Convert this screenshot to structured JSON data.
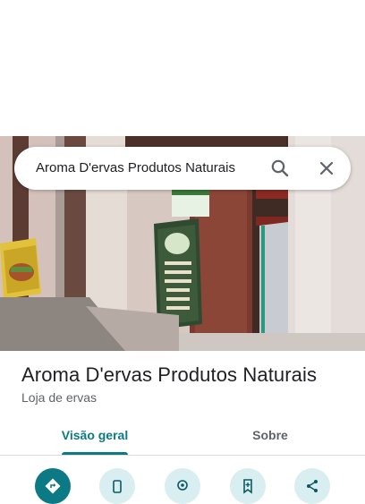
{
  "search": {
    "query": "Aroma D'ervas Produtos Naturais"
  },
  "place": {
    "name": "Aroma D'ervas Produtos Naturais",
    "category": "Loja de ervas"
  },
  "tabs": [
    {
      "label": "Visão geral",
      "active": true
    },
    {
      "label": "Sobre",
      "active": false
    }
  ],
  "actions": [
    {
      "icon": "directions-icon"
    },
    {
      "icon": "phone-icon"
    },
    {
      "icon": "location-icon"
    },
    {
      "icon": "save-icon"
    },
    {
      "icon": "share-icon"
    }
  ],
  "colors": {
    "accent": "#0b7a84",
    "action_bg": "#d8eef0"
  }
}
